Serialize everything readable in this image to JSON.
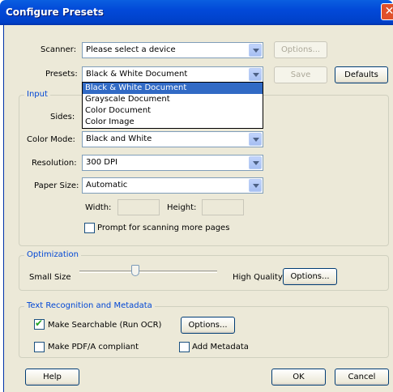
{
  "window": {
    "title": "Configure Presets",
    "close_glyph": "✕"
  },
  "scanner": {
    "label": "Scanner:",
    "value": "Please select a device",
    "options_label": "Options..."
  },
  "presets": {
    "label": "Presets:",
    "value": "Black & White Document",
    "save_label": "Save",
    "defaults_label": "Defaults",
    "dropdown_options": [
      "Black & White Document",
      "Grayscale Document",
      "Color Document",
      "Color Image"
    ],
    "selected_index": 0
  },
  "input": {
    "legend": "Input",
    "sides_label": "Sides:",
    "color_mode_label": "Color Mode:",
    "color_mode_value": "Black and White",
    "resolution_label": "Resolution:",
    "resolution_value": "300 DPI",
    "paper_size_label": "Paper Size:",
    "paper_size_value": "Automatic",
    "width_label": "Width:",
    "height_label": "Height:",
    "prompt_label": "Prompt for scanning more pages",
    "prompt_checked": false
  },
  "optimization": {
    "legend": "Optimization",
    "small_label": "Small Size",
    "high_label": "High Quality",
    "options_label": "Options...",
    "slider_value": 0.4
  },
  "ocr": {
    "legend": "Text Recognition and Metadata",
    "searchable_label": "Make Searchable (Run OCR)",
    "searchable_checked": true,
    "options_label": "Options...",
    "pdfa_label": "Make PDF/A compliant",
    "pdfa_checked": false,
    "metadata_label": "Add Metadata",
    "metadata_checked": false
  },
  "footer": {
    "help_label": "Help",
    "ok_label": "OK",
    "cancel_label": "Cancel"
  },
  "icons": {
    "check": "✔",
    "close": "close-icon",
    "dropdown": "chevron-down-icon"
  }
}
